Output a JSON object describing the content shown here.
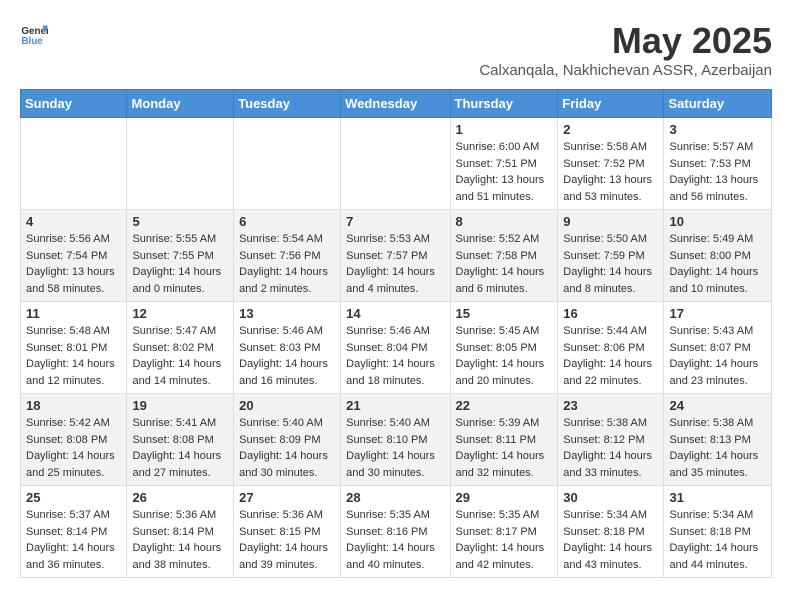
{
  "header": {
    "logo": {
      "general": "General",
      "blue": "Blue"
    },
    "title": "May 2025",
    "subtitle": "Calxanqala, Nakhichevan ASSR, Azerbaijan"
  },
  "weekdays": [
    "Sunday",
    "Monday",
    "Tuesday",
    "Wednesday",
    "Thursday",
    "Friday",
    "Saturday"
  ],
  "weeks": [
    [
      {
        "day": "",
        "sunrise": "",
        "sunset": "",
        "daylight": ""
      },
      {
        "day": "",
        "sunrise": "",
        "sunset": "",
        "daylight": ""
      },
      {
        "day": "",
        "sunrise": "",
        "sunset": "",
        "daylight": ""
      },
      {
        "day": "",
        "sunrise": "",
        "sunset": "",
        "daylight": ""
      },
      {
        "day": "1",
        "sunrise": "Sunrise: 6:00 AM",
        "sunset": "Sunset: 7:51 PM",
        "daylight": "Daylight: 13 hours and 51 minutes."
      },
      {
        "day": "2",
        "sunrise": "Sunrise: 5:58 AM",
        "sunset": "Sunset: 7:52 PM",
        "daylight": "Daylight: 13 hours and 53 minutes."
      },
      {
        "day": "3",
        "sunrise": "Sunrise: 5:57 AM",
        "sunset": "Sunset: 7:53 PM",
        "daylight": "Daylight: 13 hours and 56 minutes."
      }
    ],
    [
      {
        "day": "4",
        "sunrise": "Sunrise: 5:56 AM",
        "sunset": "Sunset: 7:54 PM",
        "daylight": "Daylight: 13 hours and 58 minutes."
      },
      {
        "day": "5",
        "sunrise": "Sunrise: 5:55 AM",
        "sunset": "Sunset: 7:55 PM",
        "daylight": "Daylight: 14 hours and 0 minutes."
      },
      {
        "day": "6",
        "sunrise": "Sunrise: 5:54 AM",
        "sunset": "Sunset: 7:56 PM",
        "daylight": "Daylight: 14 hours and 2 minutes."
      },
      {
        "day": "7",
        "sunrise": "Sunrise: 5:53 AM",
        "sunset": "Sunset: 7:57 PM",
        "daylight": "Daylight: 14 hours and 4 minutes."
      },
      {
        "day": "8",
        "sunrise": "Sunrise: 5:52 AM",
        "sunset": "Sunset: 7:58 PM",
        "daylight": "Daylight: 14 hours and 6 minutes."
      },
      {
        "day": "9",
        "sunrise": "Sunrise: 5:50 AM",
        "sunset": "Sunset: 7:59 PM",
        "daylight": "Daylight: 14 hours and 8 minutes."
      },
      {
        "day": "10",
        "sunrise": "Sunrise: 5:49 AM",
        "sunset": "Sunset: 8:00 PM",
        "daylight": "Daylight: 14 hours and 10 minutes."
      }
    ],
    [
      {
        "day": "11",
        "sunrise": "Sunrise: 5:48 AM",
        "sunset": "Sunset: 8:01 PM",
        "daylight": "Daylight: 14 hours and 12 minutes."
      },
      {
        "day": "12",
        "sunrise": "Sunrise: 5:47 AM",
        "sunset": "Sunset: 8:02 PM",
        "daylight": "Daylight: 14 hours and 14 minutes."
      },
      {
        "day": "13",
        "sunrise": "Sunrise: 5:46 AM",
        "sunset": "Sunset: 8:03 PM",
        "daylight": "Daylight: 14 hours and 16 minutes."
      },
      {
        "day": "14",
        "sunrise": "Sunrise: 5:46 AM",
        "sunset": "Sunset: 8:04 PM",
        "daylight": "Daylight: 14 hours and 18 minutes."
      },
      {
        "day": "15",
        "sunrise": "Sunrise: 5:45 AM",
        "sunset": "Sunset: 8:05 PM",
        "daylight": "Daylight: 14 hours and 20 minutes."
      },
      {
        "day": "16",
        "sunrise": "Sunrise: 5:44 AM",
        "sunset": "Sunset: 8:06 PM",
        "daylight": "Daylight: 14 hours and 22 minutes."
      },
      {
        "day": "17",
        "sunrise": "Sunrise: 5:43 AM",
        "sunset": "Sunset: 8:07 PM",
        "daylight": "Daylight: 14 hours and 23 minutes."
      }
    ],
    [
      {
        "day": "18",
        "sunrise": "Sunrise: 5:42 AM",
        "sunset": "Sunset: 8:08 PM",
        "daylight": "Daylight: 14 hours and 25 minutes."
      },
      {
        "day": "19",
        "sunrise": "Sunrise: 5:41 AM",
        "sunset": "Sunset: 8:08 PM",
        "daylight": "Daylight: 14 hours and 27 minutes."
      },
      {
        "day": "20",
        "sunrise": "Sunrise: 5:40 AM",
        "sunset": "Sunset: 8:09 PM",
        "daylight": "Daylight: 14 hours and 30 minutes."
      },
      {
        "day": "21",
        "sunrise": "Sunrise: 5:40 AM",
        "sunset": "Sunset: 8:10 PM",
        "daylight": "Daylight: 14 hours and 30 minutes."
      },
      {
        "day": "22",
        "sunrise": "Sunrise: 5:39 AM",
        "sunset": "Sunset: 8:11 PM",
        "daylight": "Daylight: 14 hours and 32 minutes."
      },
      {
        "day": "23",
        "sunrise": "Sunrise: 5:38 AM",
        "sunset": "Sunset: 8:12 PM",
        "daylight": "Daylight: 14 hours and 33 minutes."
      },
      {
        "day": "24",
        "sunrise": "Sunrise: 5:38 AM",
        "sunset": "Sunset: 8:13 PM",
        "daylight": "Daylight: 14 hours and 35 minutes."
      }
    ],
    [
      {
        "day": "25",
        "sunrise": "Sunrise: 5:37 AM",
        "sunset": "Sunset: 8:14 PM",
        "daylight": "Daylight: 14 hours and 36 minutes."
      },
      {
        "day": "26",
        "sunrise": "Sunrise: 5:36 AM",
        "sunset": "Sunset: 8:14 PM",
        "daylight": "Daylight: 14 hours and 38 minutes."
      },
      {
        "day": "27",
        "sunrise": "Sunrise: 5:36 AM",
        "sunset": "Sunset: 8:15 PM",
        "daylight": "Daylight: 14 hours and 39 minutes."
      },
      {
        "day": "28",
        "sunrise": "Sunrise: 5:35 AM",
        "sunset": "Sunset: 8:16 PM",
        "daylight": "Daylight: 14 hours and 40 minutes."
      },
      {
        "day": "29",
        "sunrise": "Sunrise: 5:35 AM",
        "sunset": "Sunset: 8:17 PM",
        "daylight": "Daylight: 14 hours and 42 minutes."
      },
      {
        "day": "30",
        "sunrise": "Sunrise: 5:34 AM",
        "sunset": "Sunset: 8:18 PM",
        "daylight": "Daylight: 14 hours and 43 minutes."
      },
      {
        "day": "31",
        "sunrise": "Sunrise: 5:34 AM",
        "sunset": "Sunset: 8:18 PM",
        "daylight": "Daylight: 14 hours and 44 minutes."
      }
    ]
  ]
}
